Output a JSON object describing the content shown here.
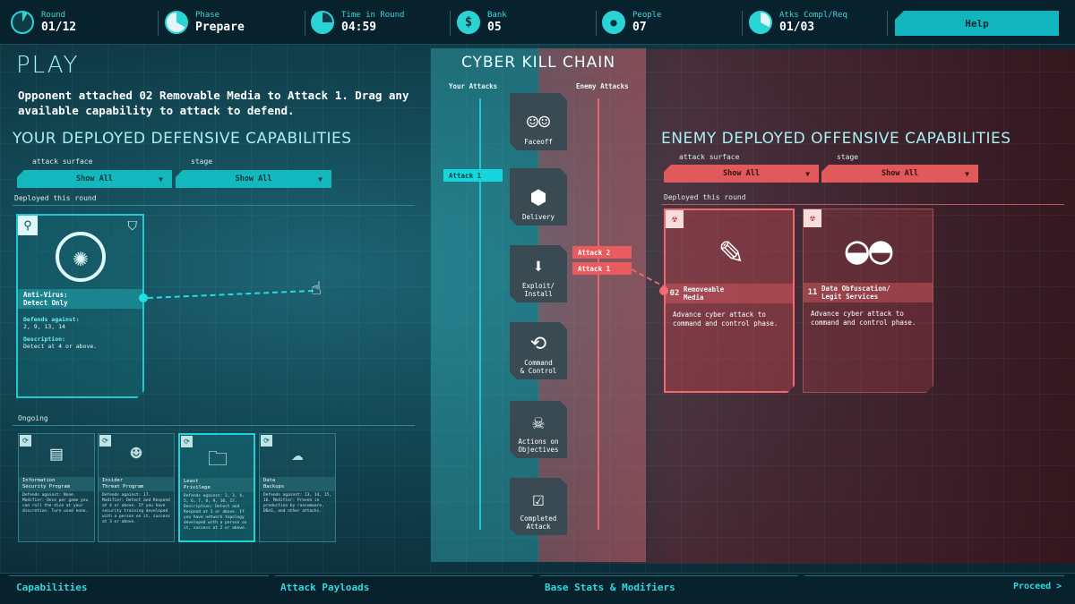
{
  "topbar": {
    "stats": [
      {
        "label": "Round",
        "value": "01/12",
        "icon": "round-pie-icon"
      },
      {
        "label": "Phase",
        "value": "Prepare",
        "icon": "phase-pie-icon"
      },
      {
        "label": "Time in Round",
        "value": "04:59",
        "icon": "timer-pie-icon"
      },
      {
        "label": "Bank",
        "value": "05",
        "icon": "dollar-icon"
      },
      {
        "label": "People",
        "value": "07",
        "icon": "person-icon"
      },
      {
        "label": "Atks Compl/Req",
        "value": "01/03",
        "icon": "attacks-pie-icon"
      }
    ],
    "help_label": "Help"
  },
  "play": {
    "title": "PLAY",
    "instruction": "Opponent attached 02 Removable Media to Attack 1. Drag any available capability to attack to defend."
  },
  "defense": {
    "heading": "YOUR DEPLOYED DEFENSIVE CAPABILITIES",
    "filter1_label": "attack surface",
    "filter1_value": "Show All",
    "filter2_label": "stage",
    "filter2_value": "Show All",
    "deployed_label": "Deployed this round",
    "card": {
      "title_line1": "Anti-Virus:",
      "title_line2": "Detect Only",
      "defends_label": "Defends against:",
      "defends_value": "2, 9, 13, 14",
      "description_label": "Description:",
      "description_value": "Detect at 4 or above."
    },
    "ongoing_label": "Ongoing",
    "ongoing": [
      {
        "title": "Information\nSecurity Program",
        "desc": "Defends against: None. Modifier: Once per game you can roll the dice at your discretion. Turn used none."
      },
      {
        "title": "Insider\nThreat Program",
        "desc": "Defends against: 17. Modifier: Detect and Respond at 4 or above. If you have security training developed with a person on it, success at 3 or above."
      },
      {
        "title": "Least\nPrivilege",
        "desc": "Defends against: 2, 3, 4, 5, 6, 7, 8, 9, 10, 17. Description: Detect and Respond at 3 or above. If you have network topology developed with a person on it, success at 2 or above."
      },
      {
        "title": "Data\nBackups",
        "desc": "Defends against: 13, 14, 15, 16. Modifier: Proven in production by ransomware, DDoS, and other attacks."
      }
    ]
  },
  "killchain": {
    "title": "CYBER KILL CHAIN",
    "your_attacks": "Your Attacks",
    "enemy_attacks": "Enemy Attacks",
    "stages": [
      {
        "label": "Faceoff",
        "icon": "faceoff-icon"
      },
      {
        "label": "Delivery",
        "icon": "cube-icon"
      },
      {
        "label": "Exploit/\nInstall",
        "icon": "download-icon"
      },
      {
        "label": "Command\n& Control",
        "icon": "command-icon"
      },
      {
        "label": "Actions on\nObjectives",
        "icon": "skull-icon"
      },
      {
        "label": "Completed\nAttack",
        "icon": "checkbox-icon"
      }
    ],
    "your_tag": "Attack 1",
    "enemy_tags": [
      "Attack 2",
      "Attack 1"
    ]
  },
  "offense": {
    "heading": "ENEMY DEPLOYED OFFENSIVE CAPABILITIES",
    "filter1_label": "attack surface",
    "filter1_value": "Show All",
    "filter2_label": "stage",
    "filter2_value": "Show All",
    "deployed_label": "Deployed this round",
    "cards": [
      {
        "num": "02",
        "title": "Removeable\nMedia",
        "desc": "Advance cyber attack to command and control phase.",
        "icon": "usb-drive-icon"
      },
      {
        "num": "11",
        "title": "Data Obfuscation/\nLegit Services",
        "desc": "Advance cyber attack to command and control phase.",
        "icon": "mask-icon"
      }
    ]
  },
  "bottom": {
    "links": [
      "Capabilities",
      "Attack Payloads",
      "Base Stats & Modifiers"
    ],
    "proceed": "Proceed >"
  },
  "colors": {
    "accent": "#13b8be",
    "enemy": "#e0595b",
    "bg": "#0b2a36"
  }
}
